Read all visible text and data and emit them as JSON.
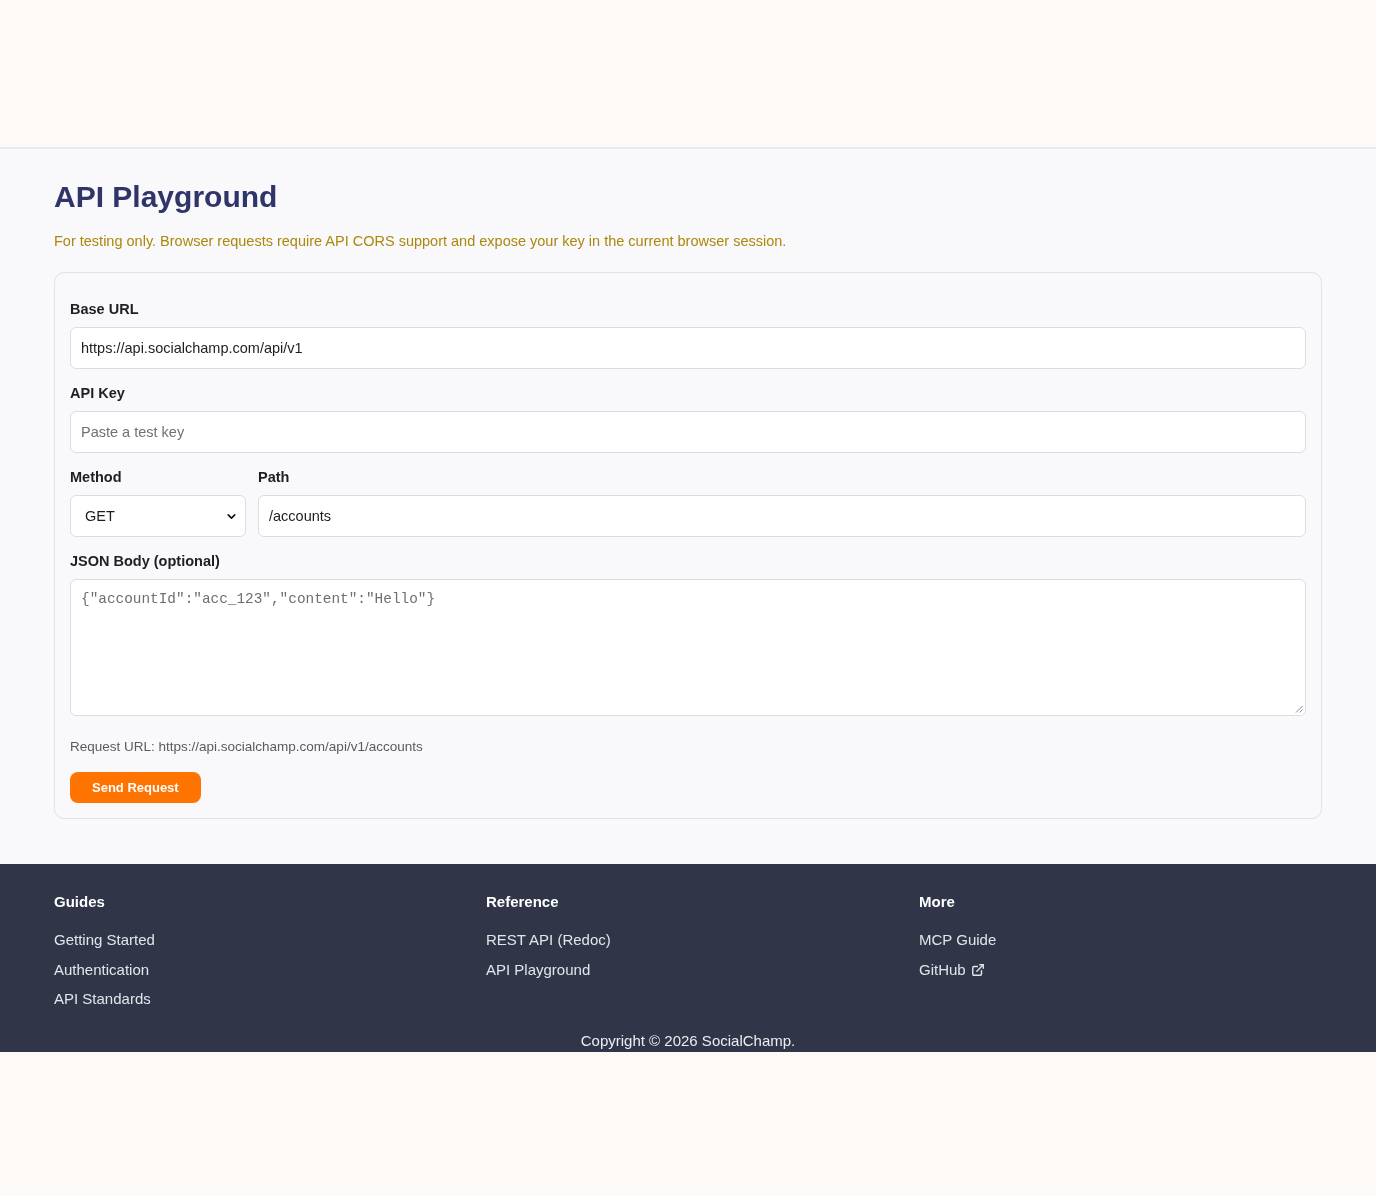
{
  "header": {
    "title": "API Playground",
    "notice": "For testing only. Browser requests require API CORS support and expose your key in the current browser session."
  },
  "form": {
    "base_url": {
      "label": "Base URL",
      "value": "https://api.socialchamp.com/api/v1"
    },
    "api_key": {
      "label": "API Key",
      "placeholder": "Paste a test key"
    },
    "method": {
      "label": "Method",
      "value": "GET"
    },
    "path": {
      "label": "Path",
      "value": "/accounts"
    },
    "json_body": {
      "label": "JSON Body (optional)",
      "placeholder": "{\"accountId\":\"acc_123\",\"content\":\"Hello\"}"
    },
    "request_url": "Request URL: https://api.socialchamp.com/api/v1/accounts",
    "submit_button": "Send Request"
  },
  "footer": {
    "columns": [
      {
        "heading": "Guides",
        "links": [
          {
            "label": "Getting Started",
            "external": false
          },
          {
            "label": "Authentication",
            "external": false
          },
          {
            "label": "API Standards",
            "external": false
          }
        ]
      },
      {
        "heading": "Reference",
        "links": [
          {
            "label": "REST API (Redoc)",
            "external": false
          },
          {
            "label": "API Playground",
            "external": false
          }
        ]
      },
      {
        "heading": "More",
        "links": [
          {
            "label": "MCP Guide",
            "external": false
          },
          {
            "label": "GitHub",
            "external": true
          }
        ]
      }
    ],
    "copyright": "Copyright © 2026 SocialChamp."
  }
}
